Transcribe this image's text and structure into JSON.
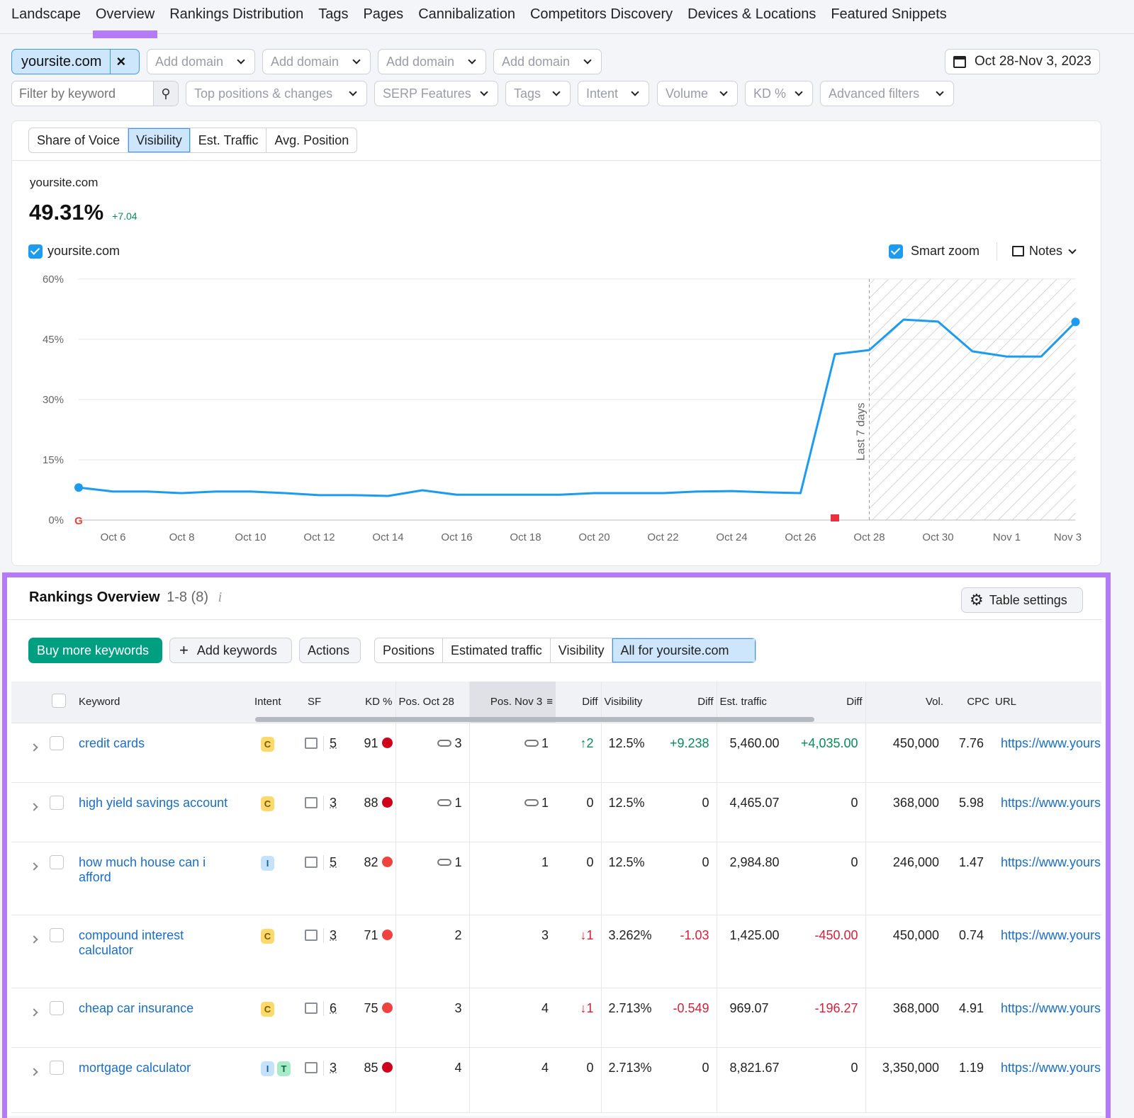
{
  "nav": {
    "tabs": [
      "Landscape",
      "Overview",
      "Rankings Distribution",
      "Tags",
      "Pages",
      "Cannibalization",
      "Competitors Discovery",
      "Devices & Locations",
      "Featured Snippets"
    ],
    "active": "Overview"
  },
  "domains": {
    "main": "yoursite.com",
    "add": [
      "Add domain",
      "Add domain",
      "Add domain",
      "Add domain"
    ]
  },
  "date_range": "Oct 28-Nov 3, 2023",
  "filters": {
    "keyword_placeholder": "Filter by keyword",
    "dropdowns": [
      "Top positions & changes",
      "SERP Features",
      "Tags",
      "Intent",
      "Volume",
      "KD %",
      "Advanced filters"
    ]
  },
  "chart_tabs": [
    "Share of Voice",
    "Visibility",
    "Est. Traffic",
    "Avg. Position"
  ],
  "chart_tab_active": "Visibility",
  "summary": {
    "domain": "yoursite.com",
    "value": "49.31%",
    "change": "+7.04"
  },
  "legend": {
    "series": "yoursite.com",
    "smart_zoom": "Smart zoom",
    "notes": "Notes"
  },
  "colors": {
    "accent": "#1c9bf0",
    "highlight": "#b57af7",
    "green": "#0a8a5a",
    "red": "#d6203c",
    "primary_button": "#009f81"
  },
  "chart_data": {
    "type": "line",
    "ylim": [
      0,
      60
    ],
    "yticks": [
      "0%",
      "15%",
      "30%",
      "45%",
      "60%"
    ],
    "ytick_values": [
      0,
      15,
      30,
      45,
      60
    ],
    "grid": true,
    "x": [
      "Oct 5",
      "Oct 6",
      "Oct 7",
      "Oct 8",
      "Oct 9",
      "Oct 10",
      "Oct 11",
      "Oct 12",
      "Oct 13",
      "Oct 14",
      "Oct 15",
      "Oct 16",
      "Oct 17",
      "Oct 18",
      "Oct 19",
      "Oct 20",
      "Oct 21",
      "Oct 22",
      "Oct 23",
      "Oct 24",
      "Oct 25",
      "Oct 26",
      "Oct 27",
      "Oct 28",
      "Oct 29",
      "Oct 30",
      "Oct 31",
      "Nov 1",
      "Nov 2",
      "Nov 3"
    ],
    "xticks": [
      "Oct 6",
      "Oct 8",
      "Oct 10",
      "Oct 12",
      "Oct 14",
      "Oct 16",
      "Oct 18",
      "Oct 20",
      "Oct 22",
      "Oct 24",
      "Oct 26",
      "Oct 28",
      "Oct 30",
      "Nov 1",
      "Nov 3"
    ],
    "series": [
      {
        "name": "yoursite.com",
        "values": [
          8.1,
          7.1,
          7.1,
          6.7,
          7.1,
          7.1,
          6.7,
          6.2,
          6.2,
          6.0,
          7.4,
          6.3,
          6.3,
          6.3,
          6.3,
          6.7,
          6.7,
          6.7,
          7.1,
          7.2,
          6.9,
          6.7,
          41.3,
          42.3,
          49.9,
          49.4,
          42.0,
          40.7,
          40.7,
          49.31
        ]
      }
    ],
    "highlight_region": {
      "from": "Oct 28",
      "to": "Nov 3",
      "label": "Last 7 days"
    },
    "markers": [
      {
        "date": "Oct 5",
        "icon": "google-icon"
      },
      {
        "date": "Oct 27",
        "icon": "note-flag-icon"
      }
    ]
  },
  "rankings": {
    "title": "Rankings Overview",
    "range": "1-8 (8)",
    "table_settings": "Table settings",
    "buy": "Buy more keywords",
    "add": "Add keywords",
    "actions": "Actions",
    "views": [
      "Positions",
      "Estimated traffic",
      "Visibility",
      "All for  yoursite.com"
    ],
    "active_view": "All for  yoursite.com",
    "columns": [
      "Keyword",
      "Intent",
      "SF",
      "KD %",
      "Pos. Oct 28",
      "Pos. Nov 3",
      "Diff",
      "Visibility",
      "Diff",
      "Est. traffic",
      "Diff",
      "Vol.",
      "CPC",
      "URL"
    ],
    "rows": [
      {
        "keyword": "credit cards",
        "intent": [
          "C"
        ],
        "sf": "5",
        "kd": "91",
        "kd_color": "#d0021b",
        "pos_old": "3",
        "pos_old_link": true,
        "pos_new": "1",
        "pos_new_link": true,
        "diff": "↑2",
        "diff_dir": "up",
        "vis": "12.5%",
        "vis_diff": "+9.238",
        "traffic": "5,460.00",
        "traffic_diff": "+4,035.00",
        "vol": "450,000",
        "cpc": "7.76",
        "url": "https://www.yoursite.com"
      },
      {
        "keyword": "high yield savings account",
        "intent": [
          "C"
        ],
        "sf": "3",
        "kd": "88",
        "kd_color": "#d0021b",
        "pos_old": "1",
        "pos_old_link": true,
        "pos_new": "1",
        "pos_new_link": true,
        "diff": "0",
        "diff_dir": "none",
        "vis": "12.5%",
        "vis_diff": "0",
        "traffic": "4,465.07",
        "traffic_diff": "0",
        "vol": "368,000",
        "cpc": "5.98",
        "url": "https://www.yoursite.com"
      },
      {
        "keyword": "how much house can i afford",
        "intent": [
          "I"
        ],
        "sf": "5",
        "kd": "82",
        "kd_color": "#f0433f",
        "pos_old": "1",
        "pos_old_link": true,
        "pos_new": "1",
        "pos_new_link": false,
        "diff": "0",
        "diff_dir": "none",
        "vis": "12.5%",
        "vis_diff": "0",
        "traffic": "2,984.80",
        "traffic_diff": "0",
        "vol": "246,000",
        "cpc": "1.47",
        "url": "https://www.yoursite.com"
      },
      {
        "keyword": "compound interest calculator",
        "intent": [
          "C"
        ],
        "sf": "3",
        "kd": "71",
        "kd_color": "#f0433f",
        "pos_old": "2",
        "pos_old_link": false,
        "pos_new": "3",
        "pos_new_link": false,
        "diff": "↓1",
        "diff_dir": "down",
        "vis": "3.262%",
        "vis_diff": "-1.03",
        "traffic": "1,425.00",
        "traffic_diff": "-450.00",
        "vol": "450,000",
        "cpc": "0.74",
        "url": "https://www.yoursite.com"
      },
      {
        "keyword": "cheap car insurance",
        "intent": [
          "C"
        ],
        "sf": "6",
        "kd": "75",
        "kd_color": "#f0433f",
        "pos_old": "3",
        "pos_old_link": false,
        "pos_new": "4",
        "pos_new_link": false,
        "diff": "↓1",
        "diff_dir": "down",
        "vis": "2.713%",
        "vis_diff": "-0.549",
        "traffic": "969.07",
        "traffic_diff": "-196.27",
        "vol": "368,000",
        "cpc": "4.91",
        "url": "https://www.yoursite.com"
      },
      {
        "keyword": "mortgage calculator",
        "intent": [
          "I",
          "T"
        ],
        "sf": "3",
        "kd": "85",
        "kd_color": "#d0021b",
        "pos_old": "4",
        "pos_old_link": false,
        "pos_new": "4",
        "pos_new_link": false,
        "diff": "0",
        "diff_dir": "none",
        "vis": "2.713%",
        "vis_diff": "0",
        "traffic": "8,821.67",
        "traffic_diff": "0",
        "vol": "3,350,000",
        "cpc": "1.19",
        "url": "https://www.yoursite.com"
      }
    ]
  }
}
